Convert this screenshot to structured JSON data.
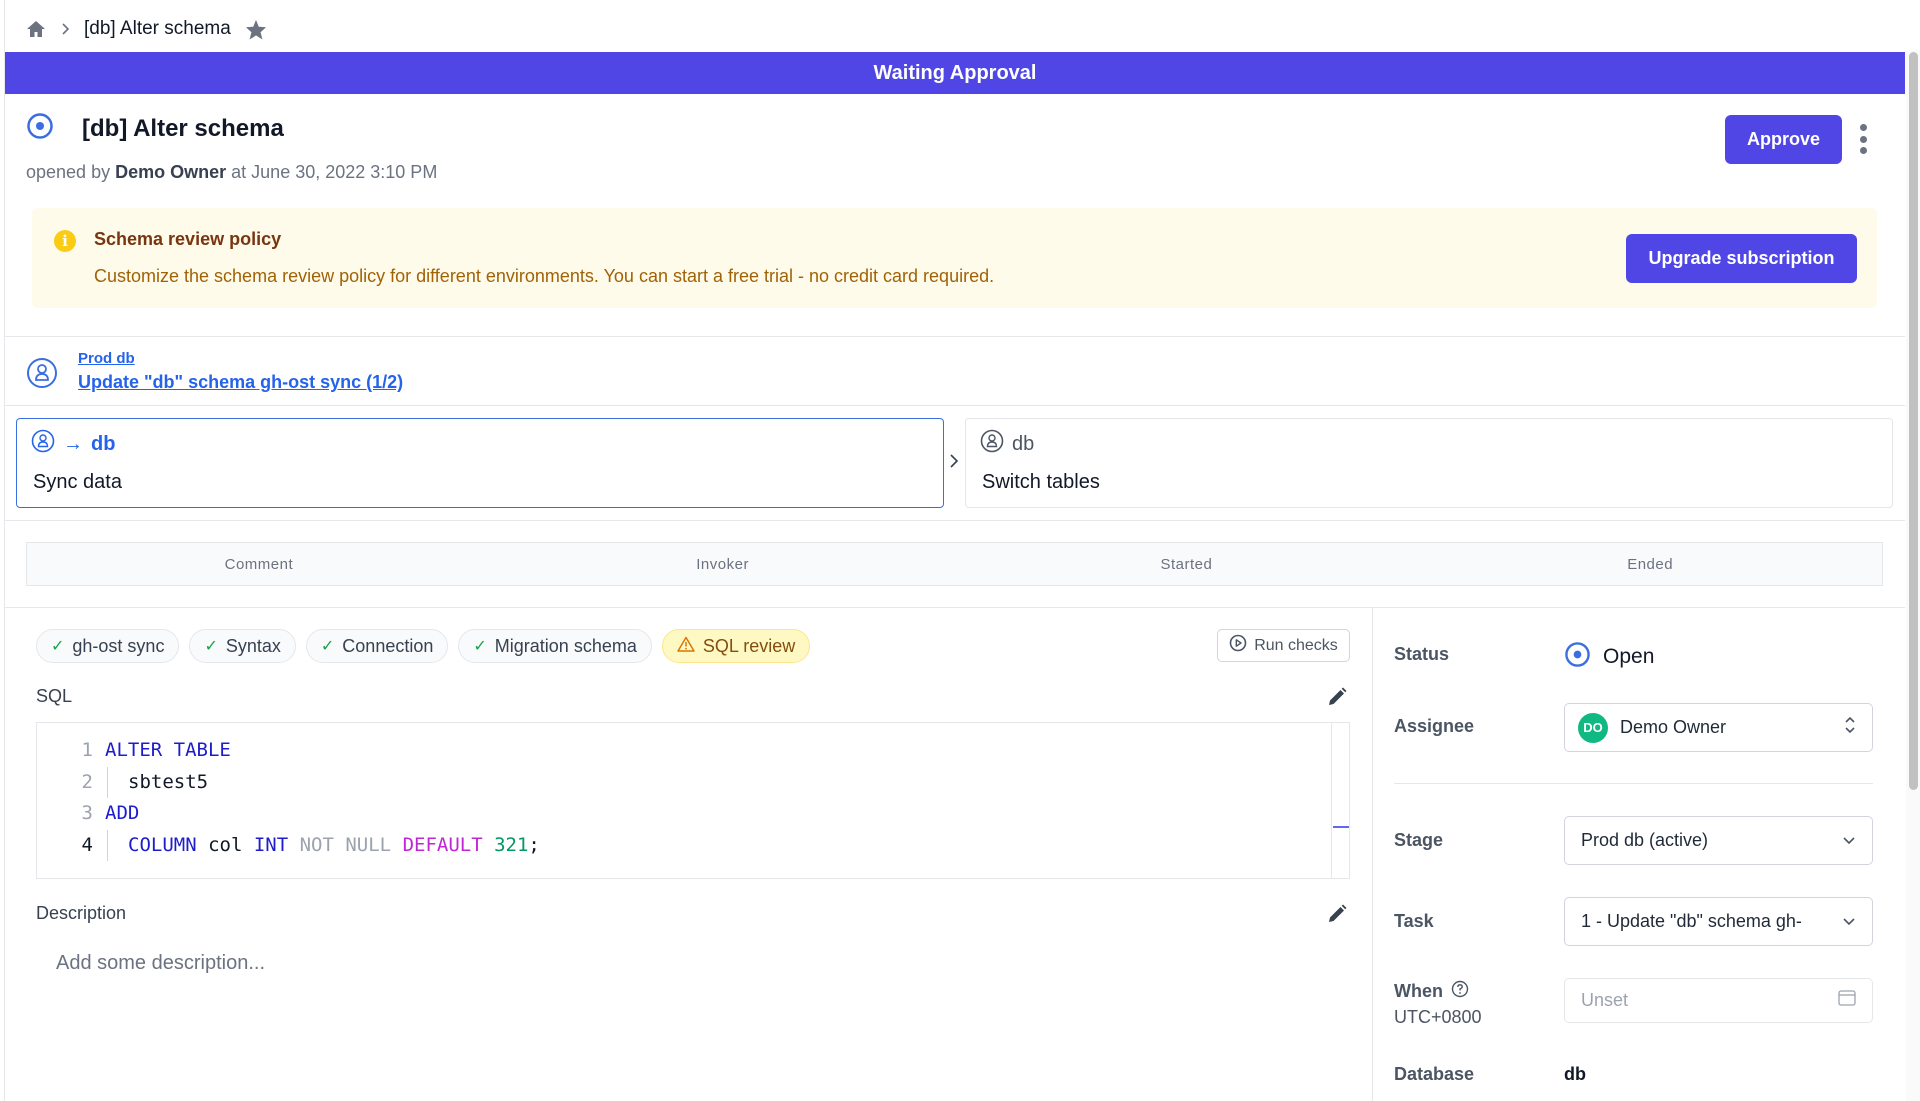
{
  "breadcrumb": {
    "home_icon": "home-icon",
    "separator_icon": "chevron-right-icon",
    "current": "[db] Alter schema",
    "star_icon": "star-icon"
  },
  "banner": {
    "text": "Waiting Approval",
    "color": "#4f46e5"
  },
  "issue": {
    "status_icon": "status-open-icon",
    "title": "[db] Alter schema",
    "opened_by_prefix": "opened by",
    "creator": "Demo Owner",
    "at_prefix": "at",
    "created_at": "June 30, 2022 3:10 PM",
    "approve_label": "Approve",
    "more_icon": "more-vertical-icon"
  },
  "alert": {
    "icon": "info-icon",
    "title": "Schema review policy",
    "text": "Customize the schema review policy for different environments. You can start a free trial - no credit card required.",
    "button_label": "Upgrade subscription"
  },
  "pipeline": {
    "environment": "Prod db",
    "task": "Update \"db\" schema gh-ost sync (1/2)"
  },
  "steps": [
    {
      "icon": "database-user-icon",
      "arrow": "→",
      "db": "db",
      "label": "Sync data",
      "active": true
    },
    {
      "icon": "database-user-icon",
      "db": "db",
      "label": "Switch tables",
      "active": false
    }
  ],
  "task_table": {
    "columns": [
      "Comment",
      "Invoker",
      "Started",
      "Ended"
    ],
    "rows": []
  },
  "checks": [
    {
      "label": "gh-ost sync",
      "status": "success"
    },
    {
      "label": "Syntax",
      "status": "success"
    },
    {
      "label": "Connection",
      "status": "success"
    },
    {
      "label": "Migration schema",
      "status": "success"
    },
    {
      "label": "SQL review",
      "status": "warning"
    }
  ],
  "run_checks_label": "Run checks",
  "sql": {
    "label": "SQL",
    "lines": [
      {
        "n": "1",
        "tokens": [
          {
            "t": "ALTER TABLE",
            "c": "kw"
          }
        ]
      },
      {
        "n": "2",
        "tokens": [
          {
            "t": "sbtest5",
            "c": "id"
          }
        ]
      },
      {
        "n": "3",
        "tokens": [
          {
            "t": "ADD",
            "c": "kw"
          }
        ]
      },
      {
        "n": "4",
        "tokens": [
          {
            "t": "COLUMN",
            "c": "kw"
          },
          {
            "t": " col ",
            "c": "id"
          },
          {
            "t": "INT",
            "c": "kw"
          },
          {
            "t": " NOT NULL ",
            "c": "kw2"
          },
          {
            "t": "DEFAULT",
            "c": "kw3"
          },
          {
            "t": " 321",
            "c": "num"
          },
          {
            "t": ";",
            "c": "id"
          }
        ]
      }
    ]
  },
  "description": {
    "label": "Description",
    "placeholder": "Add some description..."
  },
  "sidebar": {
    "status_label": "Status",
    "status_value": "Open",
    "assignee_label": "Assignee",
    "assignee_initials": "DO",
    "assignee_name": "Demo Owner",
    "stage_label": "Stage",
    "stage_value": "Prod db (active)",
    "task_label": "Task",
    "task_value": "1 - Update \"db\" schema gh-",
    "when_label": "When",
    "timezone": "UTC+0800",
    "when_placeholder": "Unset",
    "database_label": "Database",
    "database_value": "db"
  }
}
